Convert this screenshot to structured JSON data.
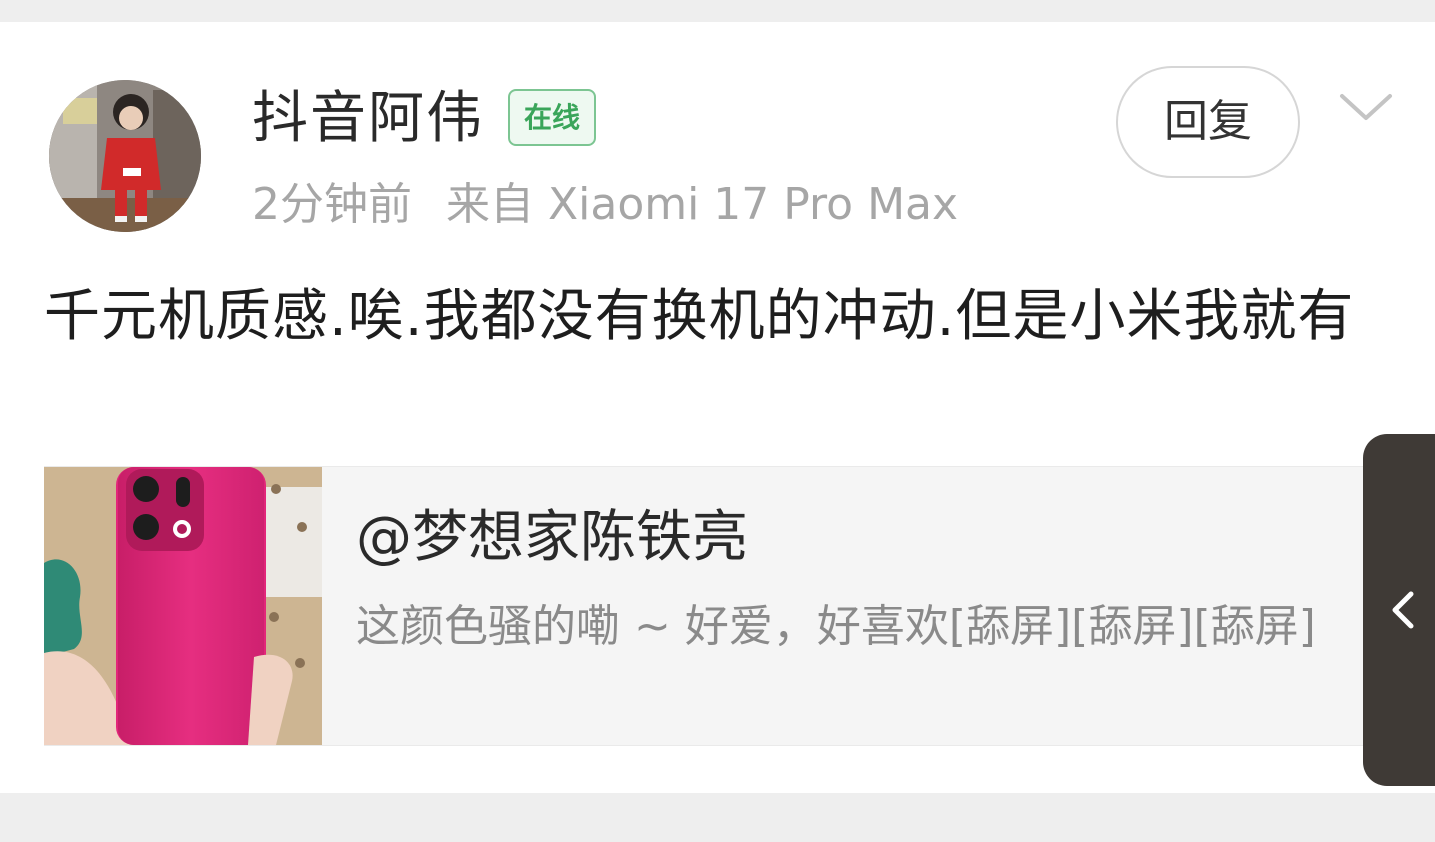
{
  "post": {
    "username": "抖音阿伟",
    "online_badge": "在线",
    "time": "2分钟前",
    "source": "来自 Xiaomi 17 Pro Max",
    "reply_label": "回复",
    "text": "千元机质感.唉.我都没有换机的冲动.但是小米我就有"
  },
  "quote": {
    "author": "@梦想家陈铁亮",
    "text": "这颜色骚的嘞 ~ 好爱，好喜欢[舔屏][舔屏][舔屏]"
  },
  "colors": {
    "online_green": "#3aa55a",
    "phone_pink": "#e2267a",
    "side_tab": "#3f3a36"
  },
  "icons": {
    "expand": "chevron-down-icon",
    "side_tab": "chevron-left-icon"
  }
}
